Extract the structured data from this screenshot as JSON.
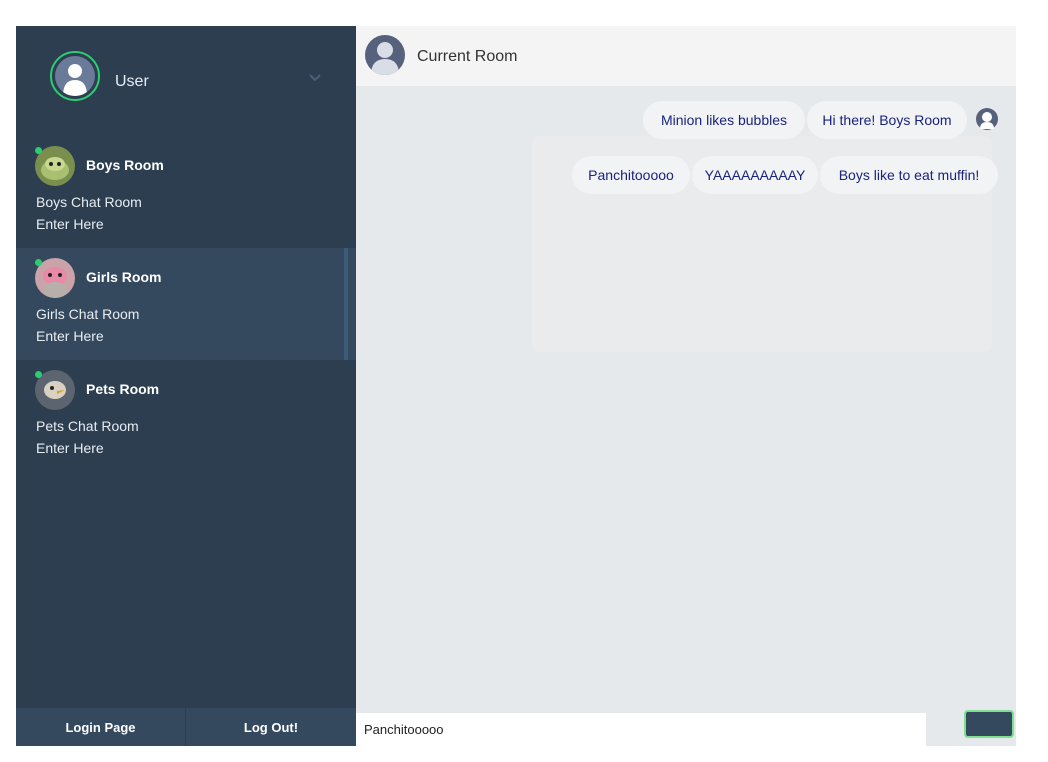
{
  "sidebar": {
    "user": {
      "name": "User"
    },
    "rooms": [
      {
        "name": "Boys Room",
        "description": "Boys Chat Room",
        "enter": "Enter Here"
      },
      {
        "name": "Girls Room",
        "description": "Girls Chat Room",
        "enter": "Enter Here"
      },
      {
        "name": "Pets Room",
        "description": "Pets Chat Room",
        "enter": "Enter Here"
      }
    ],
    "footer": {
      "login_label": "Login Page",
      "logout_label": "Log Out!"
    }
  },
  "main": {
    "header": {
      "title": "Current Room"
    },
    "messages_row1": [
      "Minion likes bubbles",
      "Hi there! Boys Room"
    ],
    "messages_row2": [
      "Panchitooooo",
      "YAAAAAAAAAY",
      "Boys like to eat muffin!"
    ],
    "input": {
      "value": "Panchitooooo"
    }
  },
  "colors": {
    "sidebar_bg": "#2d3e50",
    "active_room_bg": "#34495e",
    "online": "#2ecc71",
    "main_bg": "#e6e9eb",
    "bubble_text": "#1a237e"
  },
  "icons": [
    "user-avatar-icon",
    "chevron-down-icon",
    "send-icon"
  ]
}
